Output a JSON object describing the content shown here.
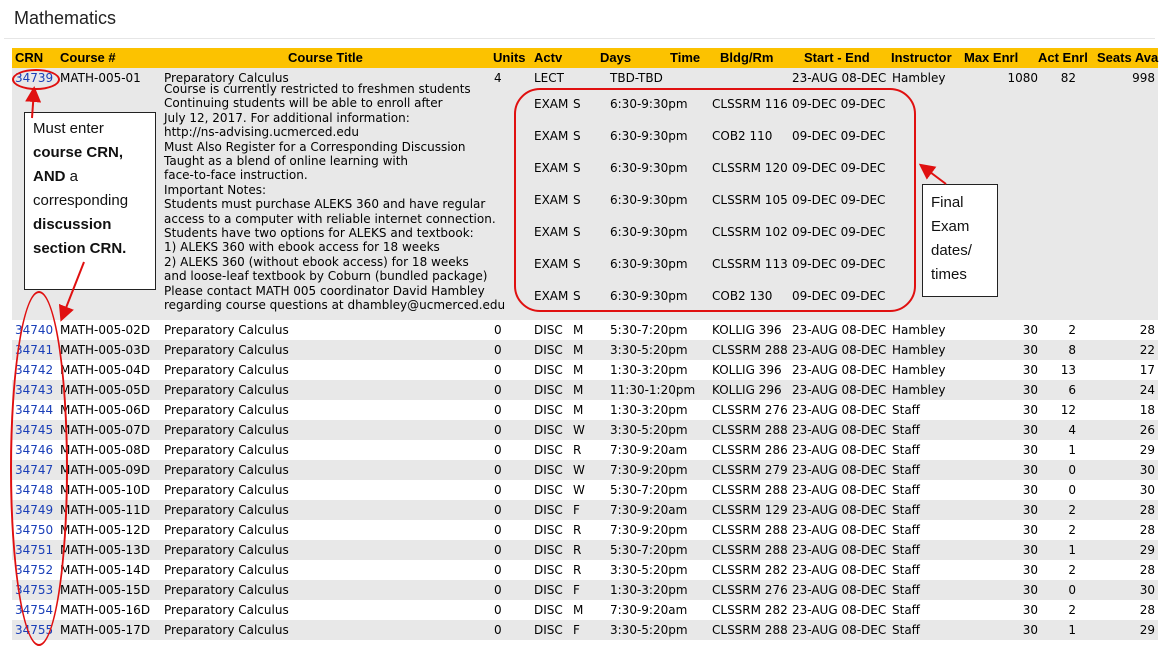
{
  "page_title": "Mathematics",
  "columns": [
    "CRN",
    "Course #",
    "Course Title",
    "Units",
    "Actv",
    "Days",
    "Time",
    "Bldg/Rm",
    "Start - End",
    "Instructor",
    "Max Enrl",
    "Act Enrl",
    "Seats Avail"
  ],
  "lecture": {
    "crn": "34739",
    "course": "MATH-005-01",
    "title": "Preparatory Calculus",
    "units": "4",
    "actv": "LECT",
    "days": "",
    "time": "TBD-TBD",
    "bldg": "",
    "start_end": "23-AUG 08-DEC",
    "instructor": "Hambley",
    "max": "1080",
    "act": "82",
    "seats": "998",
    "notes": "Course is currently restricted to freshmen students\nContinuing students will be able to enroll after\nJuly 12, 2017. For additional information:\nhttp://ns-advising.ucmerced.edu\nMust Also Register for a Corresponding Discussion\nTaught as a blend of online learning with\nface-to-face instruction.\nImportant Notes:\nStudents must purchase ALEKS 360 and have regular\naccess to a computer with reliable internet connection.\nStudents have two options for ALEKS and textbook:\n1) ALEKS 360 with ebook access for 18 weeks\n2) ALEKS 360 (without ebook access) for 18 weeks\nand loose-leaf textbook by Coburn (bundled package)\nPlease contact MATH 005 coordinator David Hambley\nregarding course questions at dhambley@ucmerced.edu",
    "exams": [
      {
        "actv": "EXAM",
        "days": "S",
        "time": "6:30-9:30pm",
        "bldg": "CLSSRM 116",
        "date": "09-DEC 09-DEC"
      },
      {
        "actv": "EXAM",
        "days": "S",
        "time": "6:30-9:30pm",
        "bldg": "COB2 110",
        "date": "09-DEC 09-DEC"
      },
      {
        "actv": "EXAM",
        "days": "S",
        "time": "6:30-9:30pm",
        "bldg": "CLSSRM 120",
        "date": "09-DEC 09-DEC"
      },
      {
        "actv": "EXAM",
        "days": "S",
        "time": "6:30-9:30pm",
        "bldg": "CLSSRM 105",
        "date": "09-DEC 09-DEC"
      },
      {
        "actv": "EXAM",
        "days": "S",
        "time": "6:30-9:30pm",
        "bldg": "CLSSRM 102",
        "date": "09-DEC 09-DEC"
      },
      {
        "actv": "EXAM",
        "days": "S",
        "time": "6:30-9:30pm",
        "bldg": "CLSSRM 113",
        "date": "09-DEC 09-DEC"
      },
      {
        "actv": "EXAM",
        "days": "S",
        "time": "6:30-9:30pm",
        "bldg": "COB2 130",
        "date": "09-DEC 09-DEC"
      }
    ]
  },
  "discussions": [
    {
      "crn": "34740",
      "course": "MATH-005-02D",
      "title": "Preparatory Calculus",
      "units": "0",
      "actv": "DISC",
      "days": "M",
      "time": "5:30-7:20pm",
      "bldg": "KOLLIG 396",
      "start_end": "23-AUG 08-DEC",
      "instructor": "Hambley",
      "max": "30",
      "act": "2",
      "seats": "28"
    },
    {
      "crn": "34741",
      "course": "MATH-005-03D",
      "title": "Preparatory Calculus",
      "units": "0",
      "actv": "DISC",
      "days": "M",
      "time": "3:30-5:20pm",
      "bldg": "CLSSRM 288",
      "start_end": "23-AUG 08-DEC",
      "instructor": "Hambley",
      "max": "30",
      "act": "8",
      "seats": "22"
    },
    {
      "crn": "34742",
      "course": "MATH-005-04D",
      "title": "Preparatory Calculus",
      "units": "0",
      "actv": "DISC",
      "days": "M",
      "time": "1:30-3:20pm",
      "bldg": "KOLLIG 396",
      "start_end": "23-AUG 08-DEC",
      "instructor": "Hambley",
      "max": "30",
      "act": "13",
      "seats": "17"
    },
    {
      "crn": "34743",
      "course": "MATH-005-05D",
      "title": "Preparatory Calculus",
      "units": "0",
      "actv": "DISC",
      "days": "M",
      "time": "11:30-1:20pm",
      "bldg": "KOLLIG 296",
      "start_end": "23-AUG 08-DEC",
      "instructor": "Hambley",
      "max": "30",
      "act": "6",
      "seats": "24"
    },
    {
      "crn": "34744",
      "course": "MATH-005-06D",
      "title": "Preparatory Calculus",
      "units": "0",
      "actv": "DISC",
      "days": "M",
      "time": "1:30-3:20pm",
      "bldg": "CLSSRM 276",
      "start_end": "23-AUG 08-DEC",
      "instructor": "Staff",
      "max": "30",
      "act": "12",
      "seats": "18"
    },
    {
      "crn": "34745",
      "course": "MATH-005-07D",
      "title": "Preparatory Calculus",
      "units": "0",
      "actv": "DISC",
      "days": "W",
      "time": "3:30-5:20pm",
      "bldg": "CLSSRM 288",
      "start_end": "23-AUG 08-DEC",
      "instructor": "Staff",
      "max": "30",
      "act": "4",
      "seats": "26"
    },
    {
      "crn": "34746",
      "course": "MATH-005-08D",
      "title": "Preparatory Calculus",
      "units": "0",
      "actv": "DISC",
      "days": "R",
      "time": "7:30-9:20am",
      "bldg": "CLSSRM 286",
      "start_end": "23-AUG 08-DEC",
      "instructor": "Staff",
      "max": "30",
      "act": "1",
      "seats": "29"
    },
    {
      "crn": "34747",
      "course": "MATH-005-09D",
      "title": "Preparatory Calculus",
      "units": "0",
      "actv": "DISC",
      "days": "W",
      "time": "7:30-9:20pm",
      "bldg": "CLSSRM 279",
      "start_end": "23-AUG 08-DEC",
      "instructor": "Staff",
      "max": "30",
      "act": "0",
      "seats": "30"
    },
    {
      "crn": "34748",
      "course": "MATH-005-10D",
      "title": "Preparatory Calculus",
      "units": "0",
      "actv": "DISC",
      "days": "W",
      "time": "5:30-7:20pm",
      "bldg": "CLSSRM 288",
      "start_end": "23-AUG 08-DEC",
      "instructor": "Staff",
      "max": "30",
      "act": "0",
      "seats": "30"
    },
    {
      "crn": "34749",
      "course": "MATH-005-11D",
      "title": "Preparatory Calculus",
      "units": "0",
      "actv": "DISC",
      "days": "F",
      "time": "7:30-9:20am",
      "bldg": "CLSSRM 129",
      "start_end": "23-AUG 08-DEC",
      "instructor": "Staff",
      "max": "30",
      "act": "2",
      "seats": "28"
    },
    {
      "crn": "34750",
      "course": "MATH-005-12D",
      "title": "Preparatory Calculus",
      "units": "0",
      "actv": "DISC",
      "days": "R",
      "time": "7:30-9:20pm",
      "bldg": "CLSSRM 288",
      "start_end": "23-AUG 08-DEC",
      "instructor": "Staff",
      "max": "30",
      "act": "2",
      "seats": "28"
    },
    {
      "crn": "34751",
      "course": "MATH-005-13D",
      "title": "Preparatory Calculus",
      "units": "0",
      "actv": "DISC",
      "days": "R",
      "time": "5:30-7:20pm",
      "bldg": "CLSSRM 288",
      "start_end": "23-AUG 08-DEC",
      "instructor": "Staff",
      "max": "30",
      "act": "1",
      "seats": "29"
    },
    {
      "crn": "34752",
      "course": "MATH-005-14D",
      "title": "Preparatory Calculus",
      "units": "0",
      "actv": "DISC",
      "days": "R",
      "time": "3:30-5:20pm",
      "bldg": "CLSSRM 282",
      "start_end": "23-AUG 08-DEC",
      "instructor": "Staff",
      "max": "30",
      "act": "2",
      "seats": "28"
    },
    {
      "crn": "34753",
      "course": "MATH-005-15D",
      "title": "Preparatory Calculus",
      "units": "0",
      "actv": "DISC",
      "days": "F",
      "time": "1:30-3:20pm",
      "bldg": "CLSSRM 276",
      "start_end": "23-AUG 08-DEC",
      "instructor": "Staff",
      "max": "30",
      "act": "0",
      "seats": "30"
    },
    {
      "crn": "34754",
      "course": "MATH-005-16D",
      "title": "Preparatory Calculus",
      "units": "0",
      "actv": "DISC",
      "days": "M",
      "time": "7:30-9:20am",
      "bldg": "CLSSRM 282",
      "start_end": "23-AUG 08-DEC",
      "instructor": "Staff",
      "max": "30",
      "act": "2",
      "seats": "28"
    },
    {
      "crn": "34755",
      "course": "MATH-005-17D",
      "title": "Preparatory Calculus",
      "units": "0",
      "actv": "DISC",
      "days": "F",
      "time": "3:30-5:20pm",
      "bldg": "CLSSRM 288",
      "start_end": "23-AUG 08-DEC",
      "instructor": "Staff",
      "max": "30",
      "act": "1",
      "seats": "29"
    }
  ],
  "annotations": {
    "crn_callout": [
      "Must enter",
      "course CRN,",
      "AND",
      " a",
      "corresponding",
      "discussion",
      "section CRN."
    ],
    "exam_callout": [
      "Final",
      "Exam",
      "dates/",
      "times"
    ],
    "annotation_color": "#e01010"
  },
  "colors": {
    "header_bg": "#fcc200",
    "row_alt": "#e8e8e8",
    "link": "#1a3fb8"
  }
}
